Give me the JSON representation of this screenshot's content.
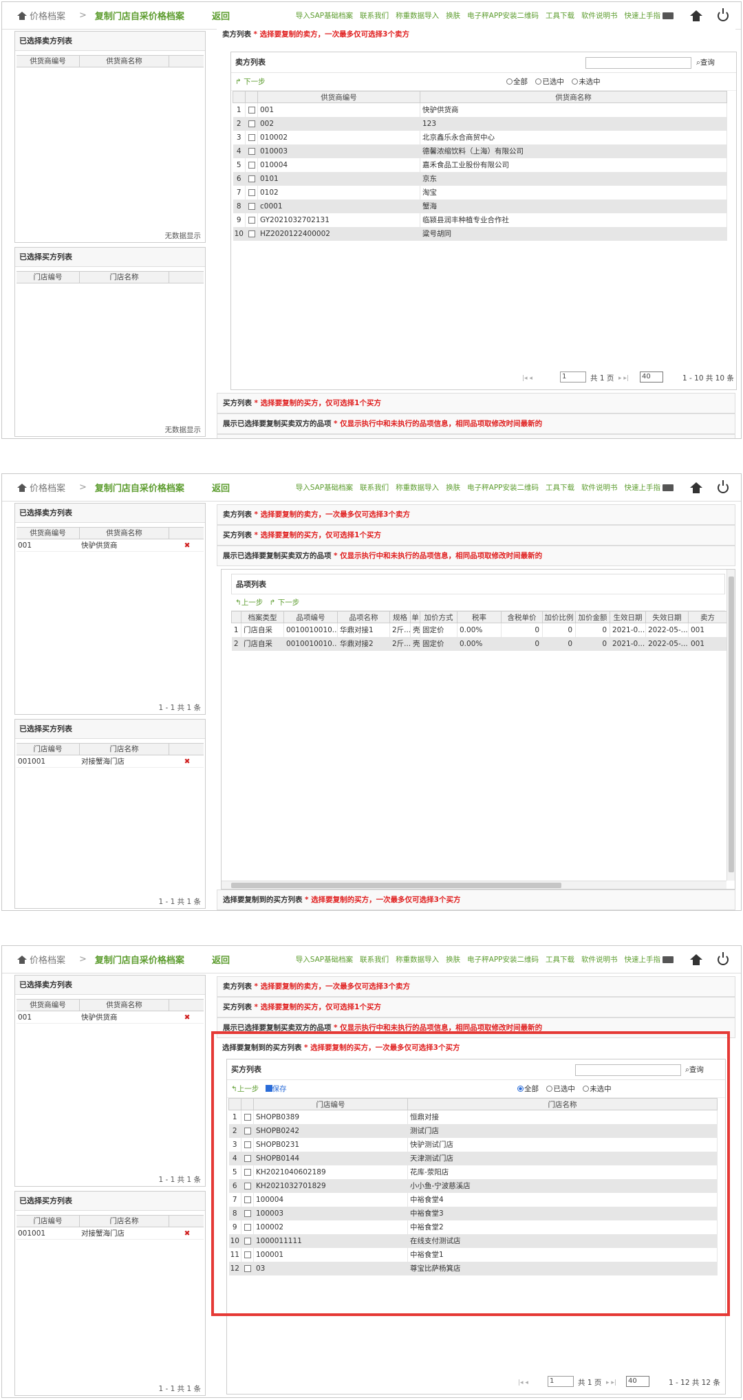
{
  "header": {
    "crumb_home": "价格档案",
    "crumb_current": "复制门店自采价格档案",
    "back": "返回",
    "menu": [
      "导入SAP基础档案",
      "联系我们",
      "称重数据导入",
      "换肤",
      "电子秤APP安装二维码",
      "工具下载",
      "软件说明书",
      "快速上手指"
    ]
  },
  "left": {
    "seller_title": "已选择卖方列表",
    "seller_cols": [
      "供货商编号",
      "供货商名称"
    ],
    "buyer_title": "已选择买方列表",
    "buyer_cols": [
      "门店编号",
      "门店名称"
    ],
    "empty": "无数据显示",
    "page_info": "1 - 1   共 1 条",
    "selected_seller": {
      "code": "001",
      "name": "快驴供货商"
    },
    "selected_buyer": {
      "code": "001001",
      "name": "对接蟹海门店"
    },
    "del": "✖"
  },
  "sections": {
    "seller": {
      "label": "卖方列表",
      "note": "* 选择要复制的卖方，一次最多仅可选择3个卖方"
    },
    "buyer": {
      "label": "买方列表",
      "note": "* 选择要复制的买方，仅可选择1个买方"
    },
    "items": {
      "label": "展示已选择要复制买卖双方的品项",
      "note": "* 仅显示执行中和未执行的品项信息，相同品项取修改时间最新的"
    },
    "target": {
      "label": "选择要复制到的买方列表",
      "note": "* 选择要复制的买方，一次最多仅可选择3个买方"
    }
  },
  "screen1": {
    "grid_title": "卖方列表",
    "search": "查询",
    "next": "下一步",
    "radios": [
      "全部",
      "已选中",
      "未选中"
    ],
    "cols": [
      "供货商编号",
      "供货商名称"
    ],
    "rows": [
      {
        "n": "1",
        "code": "001",
        "name": "快驴供货商"
      },
      {
        "n": "2",
        "code": "002",
        "name": "123"
      },
      {
        "n": "3",
        "code": "010002",
        "name": "北京鑫乐永合商贸中心"
      },
      {
        "n": "4",
        "code": "010003",
        "name": "德馨浓缩饮料（上海）有限公司"
      },
      {
        "n": "5",
        "code": "010004",
        "name": "嘉禾食品工业股份有限公司"
      },
      {
        "n": "6",
        "code": "0101",
        "name": "京东"
      },
      {
        "n": "7",
        "code": "0102",
        "name": "淘宝"
      },
      {
        "n": "8",
        "code": "c0001",
        "name": "蟹海"
      },
      {
        "n": "9",
        "code": "GY2021032702131",
        "name": "临颍县润丰种植专业合作社"
      },
      {
        "n": "10",
        "code": "HZ2020122400002",
        "name": "粱号胡同"
      }
    ],
    "pager": {
      "page": "1",
      "total_pages": "共 1 页",
      "size": "40",
      "info": "1 - 10   共 10 条"
    }
  },
  "screen2": {
    "grid_title": "品项列表",
    "prev": "上一步",
    "next": "下一步",
    "cols": [
      "档案类型",
      "品项编号",
      "品项名称",
      "规格",
      "单",
      "加价方式",
      "税率",
      "含税单价",
      "加价比例",
      "加价金额",
      "生效日期",
      "失效日期",
      "卖方"
    ],
    "rows": [
      {
        "n": "1",
        "type": "门店自采",
        "code": "0010010010...",
        "name": "华鼎对接1",
        "spec": "2斤...",
        "unit": "壳",
        "mode": "固定价",
        "tax": "0.00%",
        "price": "0",
        "ratio": "0",
        "amt": "0",
        "start": "2021-0...",
        "end": "2022-05-...",
        "seller": "001"
      },
      {
        "n": "2",
        "type": "门店自采",
        "code": "0010010010...",
        "name": "华鼎对接2",
        "spec": "2斤...",
        "unit": "壳",
        "mode": "固定价",
        "tax": "0.00%",
        "price": "0",
        "ratio": "0",
        "amt": "0",
        "start": "2021-0...",
        "end": "2022-05-...",
        "seller": "001"
      }
    ]
  },
  "screen3": {
    "grid_title": "买方列表",
    "search": "查询",
    "prev": "上一步",
    "save": "保存",
    "radios": [
      "全部",
      "已选中",
      "未选中"
    ],
    "cols": [
      "门店编号",
      "门店名称"
    ],
    "rows": [
      {
        "n": "1",
        "code": "SHOPB0389",
        "name": "恒鼎对接"
      },
      {
        "n": "2",
        "code": "SHOPB0242",
        "name": "测试门店"
      },
      {
        "n": "3",
        "code": "SHOPB0231",
        "name": "快驴测试门店"
      },
      {
        "n": "4",
        "code": "SHOPB0144",
        "name": "天津测试门店"
      },
      {
        "n": "5",
        "code": "KH2021040602189",
        "name": "花库-荥阳店"
      },
      {
        "n": "6",
        "code": "KH2021032701829",
        "name": "小小鱼-宁波慈溪店"
      },
      {
        "n": "7",
        "code": "100004",
        "name": "中裕食堂4"
      },
      {
        "n": "8",
        "code": "100003",
        "name": "中裕食堂3"
      },
      {
        "n": "9",
        "code": "100002",
        "name": "中裕食堂2"
      },
      {
        "n": "10",
        "code": "1000011111",
        "name": "在线支付测试店"
      },
      {
        "n": "11",
        "code": "100001",
        "name": "中裕食堂1"
      },
      {
        "n": "12",
        "code": "03",
        "name": "尊宝比萨杨箕店"
      }
    ],
    "pager": {
      "page": "1",
      "total_pages": "共 1 页",
      "size": "40",
      "info": "1 - 12   共 12 条"
    }
  },
  "colors": {
    "green": "#5c9c2e",
    "red": "#e02020",
    "highlight": "#e53935"
  }
}
